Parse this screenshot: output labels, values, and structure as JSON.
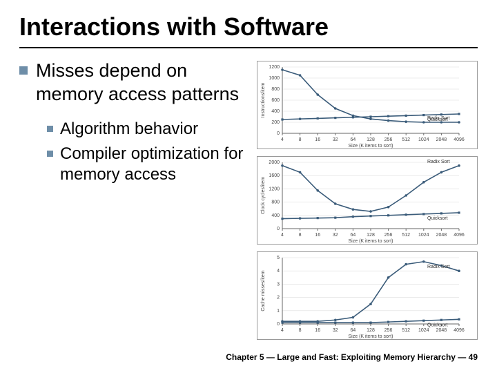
{
  "title": "Interactions with Software",
  "bullets": {
    "main": "Misses depend on memory access patterns",
    "sub1": "Algorithm behavior",
    "sub2": "Compiler optimization for memory access"
  },
  "footer": "Chapter 5 — Large and Fast: Exploiting Memory Hierarchy — 49",
  "chart_data": [
    {
      "type": "line",
      "title": "",
      "xlabel": "Size (K items to sort)",
      "ylabel": "Instructions/item",
      "x_categories": [
        "4",
        "8",
        "16",
        "32",
        "64",
        "128",
        "256",
        "512",
        "1024",
        "2048",
        "4096"
      ],
      "ylim": [
        0,
        1200
      ],
      "y_ticks": [
        0,
        200,
        400,
        600,
        800,
        1000,
        1200
      ],
      "series": [
        {
          "name": "Radix Sort",
          "values": [
            1150,
            1050,
            700,
            450,
            320,
            260,
            230,
            210,
            200,
            200,
            200
          ]
        },
        {
          "name": "Quicksort",
          "values": [
            250,
            260,
            270,
            280,
            290,
            300,
            310,
            320,
            330,
            340,
            350
          ]
        }
      ]
    },
    {
      "type": "line",
      "title": "",
      "xlabel": "Size (K items to sort)",
      "ylabel": "Clock cycles/item",
      "x_categories": [
        "4",
        "8",
        "16",
        "32",
        "64",
        "128",
        "256",
        "512",
        "1024",
        "2048",
        "4096"
      ],
      "ylim": [
        0,
        2000
      ],
      "y_ticks": [
        0,
        400,
        800,
        1200,
        1600,
        2000
      ],
      "series": [
        {
          "name": "Radix Sort",
          "values": [
            1900,
            1700,
            1150,
            750,
            580,
            520,
            650,
            1000,
            1400,
            1700,
            1900
          ]
        },
        {
          "name": "Quicksort",
          "values": [
            300,
            310,
            320,
            330,
            360,
            380,
            400,
            420,
            440,
            460,
            480
          ]
        }
      ]
    },
    {
      "type": "line",
      "title": "",
      "xlabel": "Size (K items to sort)",
      "ylabel": "Cache misses/item",
      "x_categories": [
        "4",
        "8",
        "16",
        "32",
        "64",
        "128",
        "256",
        "512",
        "1024",
        "2048",
        "4096"
      ],
      "ylim": [
        0,
        5
      ],
      "y_ticks": [
        0,
        1,
        2,
        3,
        4,
        5
      ],
      "series": [
        {
          "name": "Radix Sort",
          "values": [
            0.2,
            0.2,
            0.2,
            0.3,
            0.5,
            1.5,
            3.5,
            4.5,
            4.7,
            4.4,
            4.0
          ]
        },
        {
          "name": "Quicksort",
          "values": [
            0.1,
            0.1,
            0.1,
            0.1,
            0.1,
            0.1,
            0.15,
            0.2,
            0.25,
            0.3,
            0.35
          ]
        }
      ]
    }
  ]
}
